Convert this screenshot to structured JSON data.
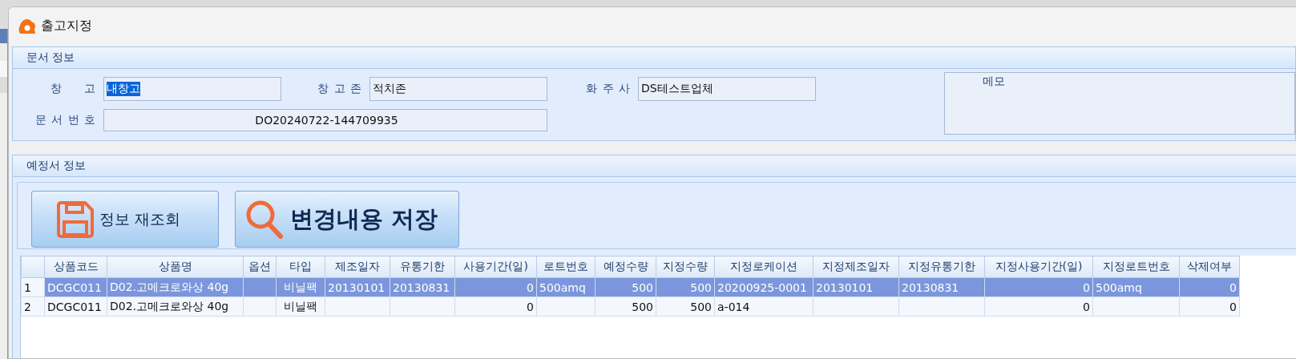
{
  "window": {
    "title": "출고지정"
  },
  "document_info": {
    "title": "문서 정보",
    "fields": [
      {
        "label": "창 고",
        "value": "내창고",
        "text_selected": true
      },
      {
        "label": "창 고 존",
        "value": "적치존",
        "text_selected": false
      },
      {
        "label": "화 주 사",
        "value": "DS테스트업체",
        "text_selected": false
      },
      {
        "label": "문 서 번 호",
        "value": "DO20240722-144709935",
        "text_selected": false
      }
    ],
    "memo": {
      "label": "메모"
    }
  },
  "schedule_info": {
    "title": "예정서 정보",
    "buttons": [
      {
        "label": "정보 재조회",
        "kind": "save"
      },
      {
        "label": "변경내용 저장",
        "kind": "search"
      }
    ],
    "table": {
      "columns": [
        "상품코드",
        "상품명",
        "옵션",
        "타입",
        "제조일자",
        "유통기한",
        "사용기간(일)",
        "로트번호",
        "예정수량",
        "지정수량",
        "지정로케이션",
        "지정제조일자",
        "지정유통기한",
        "지정사용기간(일)",
        "지정로트번호",
        "삭제여부"
      ],
      "rows": [
        {
          "number": "1",
          "selected": true,
          "cells": [
            "DCGC011",
            "D02.고메크로와상 40g",
            null,
            "비닐팩",
            "20130101",
            "20130831",
            "0",
            "500amq",
            "500",
            "500",
            "20200925-0001",
            "20130101",
            "20130831",
            "0",
            "500amq",
            "0"
          ]
        },
        {
          "number": "2",
          "selected": false,
          "cells": [
            "DCGC011",
            "D02.고메크로와상 40g",
            null,
            "비닐팩",
            null,
            null,
            "0",
            null,
            "500",
            "500",
            "a-014",
            null,
            null,
            "0",
            null,
            "0"
          ]
        }
      ]
    }
  }
}
